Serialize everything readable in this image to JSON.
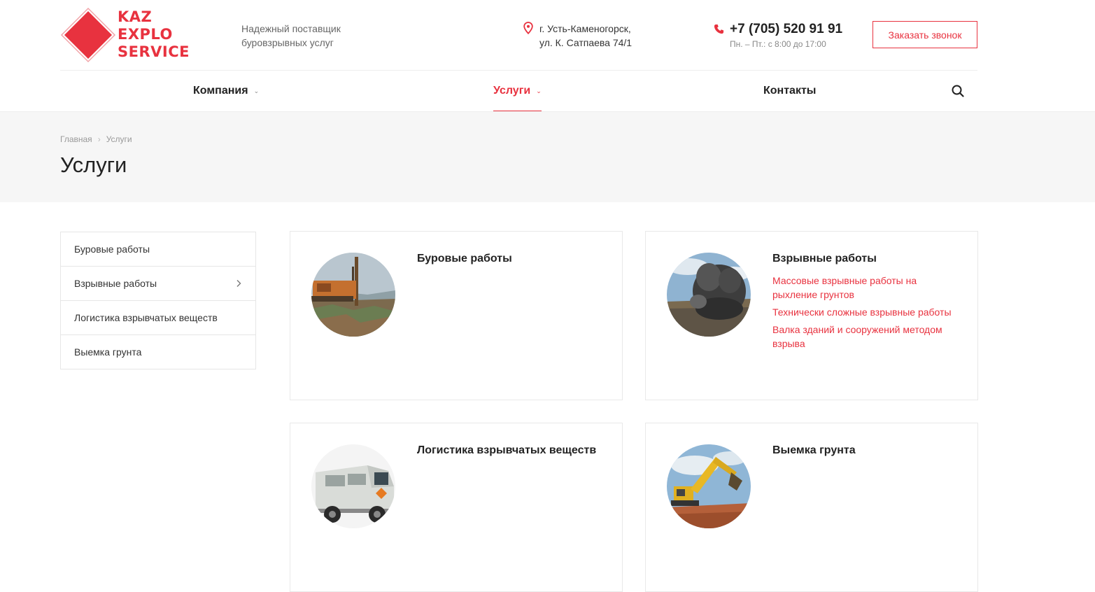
{
  "brand": {
    "logo_lines": [
      "KAZ",
      "EXPLO",
      "SERVICE"
    ],
    "tagline": "Надежный поставщик буровзрывных услуг",
    "accent_color": "#e8323f"
  },
  "contacts": {
    "address_line1": "г. Усть-Каменогорск,",
    "address_line2": "ул. К. Сатпаева 74/1",
    "phone": "+7 (705) 520 91 91",
    "hours": "Пн. – Пт.: с 8:00 до 17:00",
    "callback_label": "Заказать звонок"
  },
  "nav": {
    "items": [
      {
        "label": "Компания",
        "has_dropdown": true,
        "active": false
      },
      {
        "label": "Услуги",
        "has_dropdown": true,
        "active": true
      },
      {
        "label": "Контакты",
        "has_dropdown": false,
        "active": false
      }
    ],
    "search_icon": "search-icon"
  },
  "breadcrumb": {
    "home": "Главная",
    "current": "Услуги"
  },
  "page_title": "Услуги",
  "sidebar": {
    "items": [
      {
        "label": "Буровые работы",
        "has_submenu": false
      },
      {
        "label": "Взрывные работы",
        "has_submenu": true
      },
      {
        "label": "Логистика взрывчатых веществ",
        "has_submenu": false
      },
      {
        "label": "Выемка грунта",
        "has_submenu": false
      }
    ]
  },
  "services": [
    {
      "title": "Буровые работы",
      "image": "drilling-rig-photo",
      "links": []
    },
    {
      "title": "Взрывные работы",
      "image": "explosion-photo",
      "links": [
        "Массовые взрывные работы на рыхление грунтов",
        "Технически сложные взрывные работы",
        "Валка зданий и сооружений методом взрыва"
      ]
    },
    {
      "title": "Логистика взрывчатых веществ",
      "image": "transport-van-photo",
      "links": []
    },
    {
      "title": "Выемка грунта",
      "image": "excavator-photo",
      "links": []
    }
  ]
}
